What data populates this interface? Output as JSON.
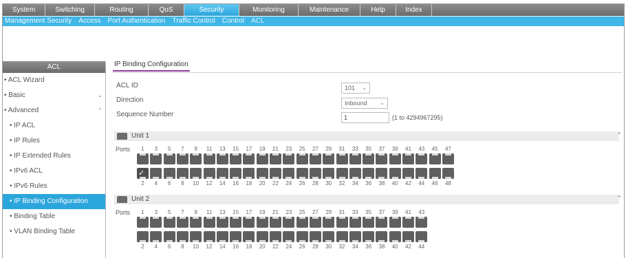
{
  "nav": {
    "items": [
      {
        "label": "System",
        "width": 62
      },
      {
        "label": "Switching",
        "width": 72
      },
      {
        "label": "Routing",
        "width": 78
      },
      {
        "label": "QoS",
        "width": 52
      },
      {
        "label": "Security",
        "width": 80
      },
      {
        "label": "Monitoring",
        "width": 86
      },
      {
        "label": "Maintenance",
        "width": 90
      },
      {
        "label": "Help",
        "width": 52
      },
      {
        "label": "Index",
        "width": 52
      }
    ],
    "active_index": 4
  },
  "subnav": {
    "items": [
      "Management Security",
      "Access",
      "Port Authentication",
      "Traffic Control",
      "Control",
      "ACL"
    ],
    "active_index": 5
  },
  "sidebar": {
    "title": "ACL",
    "items": [
      {
        "label": "• ACL Wizard",
        "sub": false
      },
      {
        "label": "• Basic",
        "sub": false,
        "caret": "⌄"
      },
      {
        "label": "• Advanced",
        "sub": false,
        "caret": "⌃"
      },
      {
        "label": "• IP ACL",
        "sub": true
      },
      {
        "label": "• IP Rules",
        "sub": true
      },
      {
        "label": "• IP Extended Rules",
        "sub": true
      },
      {
        "label": "• IPv6 ACL",
        "sub": true
      },
      {
        "label": "• IPv6 Rules",
        "sub": true
      },
      {
        "label": "• IP Binding Configuration",
        "sub": true,
        "active": true
      },
      {
        "label": "• Binding Table",
        "sub": true
      },
      {
        "label": "• VLAN Binding Table",
        "sub": true
      }
    ]
  },
  "page": {
    "tab_title": "IP Binding Configuration",
    "acl_id_label": "ACL ID",
    "acl_id_value": "101",
    "direction_label": "Direction",
    "direction_value": "Inbound",
    "sequence_label": "Sequence Number",
    "sequence_value": "1",
    "sequence_hint": "(1 to 4294967295)",
    "ports_label": "Ports"
  },
  "units": [
    {
      "label": "Unit 1",
      "port_count": 48,
      "checked_ports": [
        2
      ]
    },
    {
      "label": "Unit 2",
      "port_count": 44,
      "checked_ports": []
    }
  ],
  "colors": {
    "accent": "#2ba6dc",
    "tab_underline": "#8c3b9c",
    "port": "#5f5f5f"
  }
}
